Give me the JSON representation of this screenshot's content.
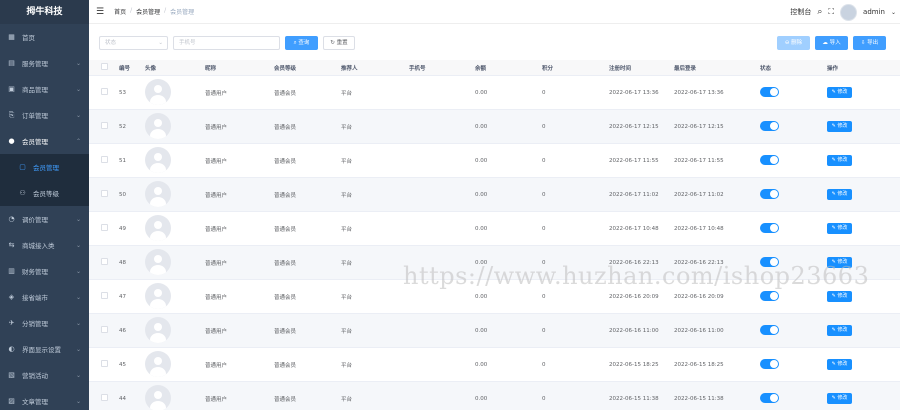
{
  "sidebar": {
    "logo": "拇牛科技",
    "items": [
      {
        "label": "首页",
        "icon": "dashboard-icon",
        "glyph": "▦",
        "caret": ""
      },
      {
        "label": "服务管理",
        "icon": "server-icon",
        "glyph": "▤",
        "caret": "⌄"
      },
      {
        "label": "商品管理",
        "icon": "goods-icon",
        "glyph": "▣",
        "caret": "⌄"
      },
      {
        "label": "订单管理",
        "icon": "order-icon",
        "glyph": "⎘",
        "caret": "⌄"
      }
    ],
    "open_item": {
      "label": "会员管理",
      "icon": "user-icon",
      "glyph": "●",
      "caret": "⌃"
    },
    "sub_items": [
      {
        "label": "会员管理",
        "icon": "member-list-icon",
        "glyph": "▢",
        "active": true
      },
      {
        "label": "会员等级",
        "icon": "member-level-icon",
        "glyph": "⚇",
        "active": false
      }
    ],
    "items_after": [
      {
        "label": "调价管理",
        "icon": "price-icon",
        "glyph": "◔",
        "caret": "⌄"
      },
      {
        "label": "商城接入类",
        "icon": "mall-icon",
        "glyph": "⇆",
        "caret": "⌄"
      },
      {
        "label": "财务管理",
        "icon": "finance-icon",
        "glyph": "▥",
        "caret": "⌄"
      },
      {
        "label": "接省端市",
        "icon": "market-icon",
        "glyph": "◈",
        "caret": "⌄"
      },
      {
        "label": "分销管理",
        "icon": "distribution-icon",
        "glyph": "✈",
        "caret": "⌄"
      },
      {
        "label": "界面显示设置",
        "icon": "display-icon",
        "glyph": "◐",
        "caret": "⌄"
      },
      {
        "label": "营销活动",
        "icon": "marketing-icon",
        "glyph": "▧",
        "caret": "⌄"
      },
      {
        "label": "文章管理",
        "icon": "article-icon",
        "glyph": "▨",
        "caret": "⌄"
      }
    ]
  },
  "header": {
    "breadcrumb": [
      "首页",
      "会员管理",
      "会员管理"
    ],
    "console": "控制台",
    "user": "admin"
  },
  "toolbar": {
    "select_placeholder": "状态",
    "search_placeholder": "手机号",
    "query_label": "查询",
    "reset_label": "重置",
    "delete_label": "删除",
    "import_label": "导入",
    "export_label": "导出"
  },
  "table": {
    "columns": [
      "",
      "编号",
      "头像",
      "昵称",
      "会员等级",
      "推荐人",
      "手机号",
      "余额",
      "积分",
      "注册时间",
      "最后登录",
      "状态",
      "操作"
    ],
    "edit_label": "修改",
    "rows": [
      {
        "id": "53",
        "nick": "普通用户",
        "level": "普通会员",
        "ref": "平台",
        "phone": "",
        "balance": "0.00",
        "points": "0",
        "reg": "2022-06-17 13:36",
        "last": "2022-06-17 13:36",
        "status": true
      },
      {
        "id": "52",
        "nick": "普通用户",
        "level": "普通会员",
        "ref": "平台",
        "phone": "",
        "balance": "0.00",
        "points": "0",
        "reg": "2022-06-17 12:15",
        "last": "2022-06-17 12:15",
        "status": true
      },
      {
        "id": "51",
        "nick": "普通用户",
        "level": "普通会员",
        "ref": "平台",
        "phone": "",
        "balance": "0.00",
        "points": "0",
        "reg": "2022-06-17 11:55",
        "last": "2022-06-17 11:55",
        "status": true
      },
      {
        "id": "50",
        "nick": "普通用户",
        "level": "普通会员",
        "ref": "平台",
        "phone": "",
        "balance": "0.00",
        "points": "0",
        "reg": "2022-06-17 11:02",
        "last": "2022-06-17 11:02",
        "status": true
      },
      {
        "id": "49",
        "nick": "普通用户",
        "level": "普通会员",
        "ref": "平台",
        "phone": "",
        "balance": "0.00",
        "points": "0",
        "reg": "2022-06-17 10:48",
        "last": "2022-06-17 10:48",
        "status": true
      },
      {
        "id": "48",
        "nick": "普通用户",
        "level": "普通会员",
        "ref": "平台",
        "phone": "",
        "balance": "0.00",
        "points": "0",
        "reg": "2022-06-16 22:13",
        "last": "2022-06-16 22:13",
        "status": true
      },
      {
        "id": "47",
        "nick": "普通用户",
        "level": "普通会员",
        "ref": "平台",
        "phone": "",
        "balance": "0.00",
        "points": "0",
        "reg": "2022-06-16 20:09",
        "last": "2022-06-16 20:09",
        "status": true
      },
      {
        "id": "46",
        "nick": "普通用户",
        "level": "普通会员",
        "ref": "平台",
        "phone": "",
        "balance": "0.00",
        "points": "0",
        "reg": "2022-06-16 11:00",
        "last": "2022-06-16 11:00",
        "status": true
      },
      {
        "id": "45",
        "nick": "普通用户",
        "level": "普通会员",
        "ref": "平台",
        "phone": "",
        "balance": "0.00",
        "points": "0",
        "reg": "2022-06-15 18:25",
        "last": "2022-06-15 18:25",
        "status": true
      },
      {
        "id": "44",
        "nick": "普通用户",
        "level": "普通会员",
        "ref": "平台",
        "phone": "",
        "balance": "0.00",
        "points": "0",
        "reg": "2022-06-15 11:38",
        "last": "2022-06-15 11:38",
        "status": true
      }
    ]
  },
  "watermark": "https://www.huzhan.com/ishop23663",
  "colors": {
    "sidebar_bg": "#304156",
    "primary": "#409eff",
    "switch_on": "#1890ff"
  }
}
